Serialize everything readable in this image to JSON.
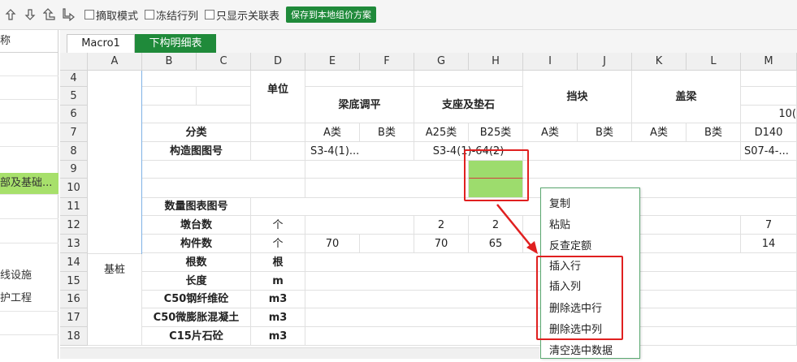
{
  "toolbar": {
    "checkboxes": [
      "摘取模式",
      "冻结行列",
      "只显示关联表"
    ],
    "save_label": "保存到本地组价方案"
  },
  "left_panel": {
    "header": "称",
    "items": [
      "部及基础...",
      "线设施",
      "护工程"
    ]
  },
  "tabs": [
    "Macro1",
    "下构明细表"
  ],
  "columns": [
    "A",
    "B",
    "C",
    "D",
    "E",
    "F",
    "G",
    "H",
    "I",
    "J",
    "K",
    "L",
    "M"
  ],
  "rows": [
    "4",
    "5",
    "6",
    "7",
    "8",
    "9",
    "10",
    "11",
    "12",
    "13",
    "14",
    "15",
    "16",
    "17",
    "18"
  ],
  "sheet": {
    "unit_header": "单位",
    "group_liangdi": "梁底调平",
    "group_zhizuo": "支座及垫石",
    "group_dangkuai": "挡块",
    "group_gailiang": "盖梁",
    "m6": "10(",
    "r7": {
      "b": "分类",
      "e": "A类",
      "f": "B类",
      "g": "A25类",
      "h": "B25类",
      "i": "A类",
      "j": "B类",
      "k": "A类",
      "l": "B类",
      "m": "D140"
    },
    "r8": {
      "b": "构造图图号",
      "e": "S3-4(1)...",
      "g": "S3-4(1)-64(2)",
      "m": "S07-4-..."
    },
    "r11": {
      "b": "数量图表图号"
    },
    "r12": {
      "b": "墩台数",
      "d": "个",
      "g": "2",
      "h": "2",
      "m": "7"
    },
    "r13": {
      "b": "构件数",
      "d": "个",
      "e": "70",
      "g": "70",
      "h": "65",
      "m": "14"
    },
    "a_merged": "基桩",
    "r14": {
      "b": "根数",
      "d": "根"
    },
    "r15": {
      "b": "长度",
      "d": "m"
    },
    "r16": {
      "b": "C50钢纤维砼",
      "d": "m3"
    },
    "r17": {
      "b": "C50微膨胀混凝土",
      "d": "m3"
    },
    "r18": {
      "b": "C15片石砼",
      "d": "m3"
    }
  },
  "context_menu": [
    "复制",
    "粘贴",
    "反查定额",
    "插入行",
    "插入列",
    "删除选中行",
    "删除选中列",
    "清空选中数据"
  ],
  "colors": {
    "accent_green": "#1f8a3a",
    "selection_green": "#9ddc6d",
    "highlight_red": "#e02020"
  }
}
